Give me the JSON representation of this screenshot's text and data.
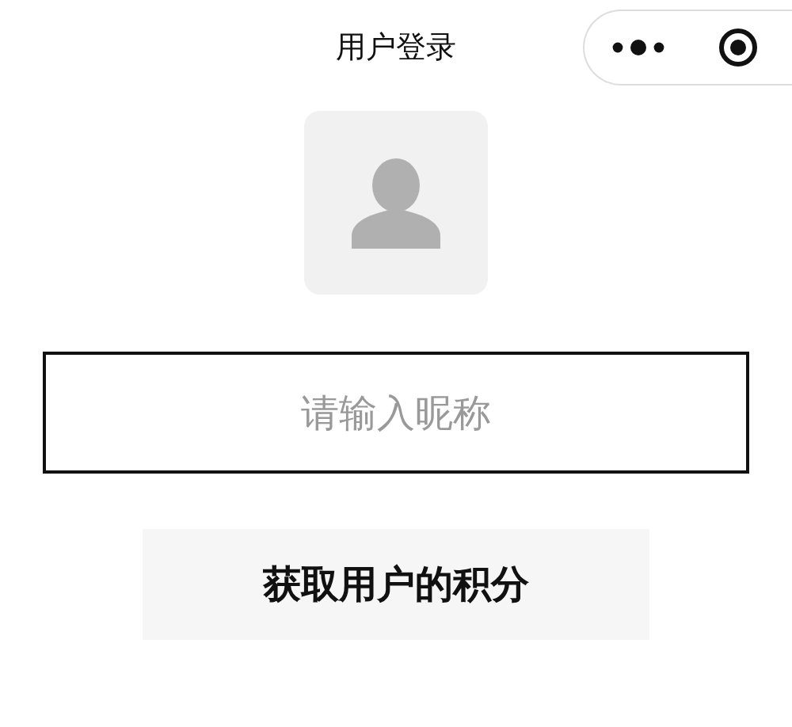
{
  "nav": {
    "title": "用户登录"
  },
  "nickname_field": {
    "placeholder": "请输入昵称"
  },
  "points_button": {
    "label": "获取用户的积分"
  }
}
